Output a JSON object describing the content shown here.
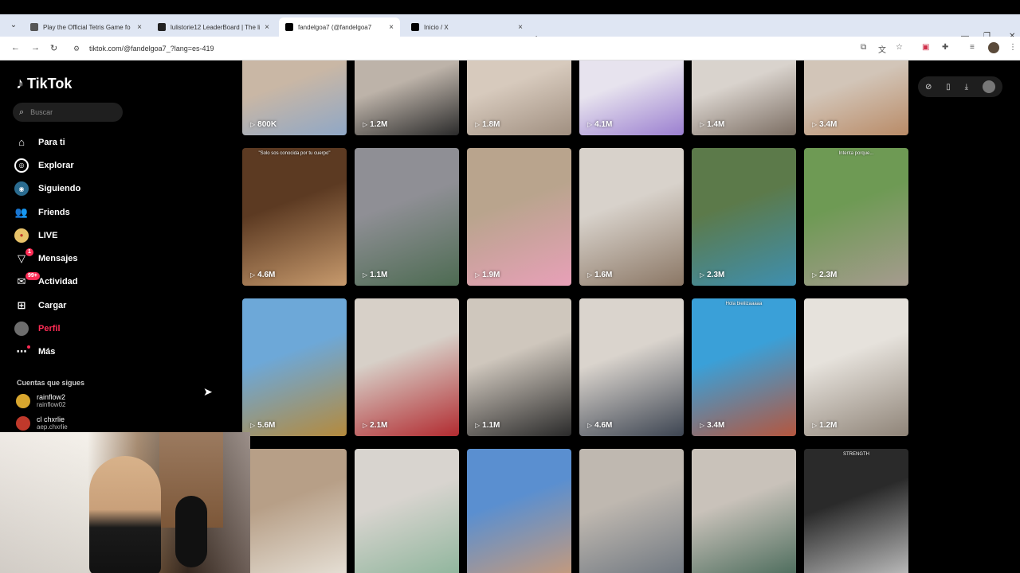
{
  "browser": {
    "tabs": [
      {
        "label": "Play the Official Tetris Game fo",
        "favicon_color": "#555555",
        "close": "×"
      },
      {
        "label": "lulistorie12 LeaderBoard | The li",
        "favicon_color": "#222222",
        "close": "×"
      },
      {
        "label": "fandelgoa7 (@fandelgoa7",
        "favicon_color": "#000000",
        "close": "×",
        "active": true
      },
      {
        "label": "Inicio / X",
        "favicon_color": "#000000",
        "close": "×"
      }
    ],
    "new_tab": "+",
    "url": "tiktok.com/@fandelgoa7_?lang=es-419"
  },
  "tiktok": {
    "logo": "TikTok",
    "search_placeholder": "Buscar",
    "nav": [
      {
        "label": "Para ti",
        "icon": "home-icon"
      },
      {
        "label": "Explorar",
        "icon": "compass-icon"
      },
      {
        "label": "Siguiendo",
        "icon": "following-icon"
      },
      {
        "label": "Friends",
        "icon": "friends-icon"
      },
      {
        "label": "LIVE",
        "icon": "live-icon"
      },
      {
        "label": "Mensajes",
        "icon": "inbox-icon",
        "badge": "1"
      },
      {
        "label": "Actividad",
        "icon": "activity-icon",
        "badge": "99+"
      },
      {
        "label": "Cargar",
        "icon": "upload-icon"
      },
      {
        "label": "Perfil",
        "icon": "profile-icon"
      },
      {
        "label": "Más",
        "icon": "more-icon"
      }
    ],
    "following_title": "Cuentas que sigues",
    "following": [
      {
        "name": "rainflow2",
        "handle": "rainflow02"
      },
      {
        "name": "cl chxrlie",
        "handle": "aep.chxrlie"
      }
    ],
    "videos": [
      {
        "views": "800K",
        "colors": [
          "#c9b7a5",
          "#8fa7c6"
        ]
      },
      {
        "views": "1.2M",
        "colors": [
          "#bdb3a9",
          "#2b2b2b"
        ]
      },
      {
        "views": "1.8M",
        "colors": [
          "#d7cabd",
          "#a08f80"
        ]
      },
      {
        "views": "4.1M",
        "colors": [
          "#e7e3ee",
          "#9b7fd0"
        ]
      },
      {
        "views": "1.4M",
        "colors": [
          "#d9d3cd",
          "#7b6d62"
        ]
      },
      {
        "views": "3.4M",
        "colors": [
          "#d2c5b8",
          "#b98b67"
        ]
      },
      {
        "views": "4.6M",
        "colors": [
          "#5c3a22",
          "#c79a6d"
        ],
        "caption": "\"Solo sos conocida por tu cuerpo\""
      },
      {
        "views": "1.1M",
        "colors": [
          "#8f8f95",
          "#4d6b52"
        ]
      },
      {
        "views": "1.9M",
        "colors": [
          "#b9a48d",
          "#e8a0b8"
        ]
      },
      {
        "views": "1.6M",
        "colors": [
          "#d8d2cb",
          "#8b7765"
        ]
      },
      {
        "views": "2.3M",
        "colors": [
          "#5c7a4a",
          "#3e8fb0"
        ]
      },
      {
        "views": "2.3M",
        "colors": [
          "#6e9a54",
          "#a69b8f"
        ],
        "caption": "Intenta porque..."
      },
      {
        "views": "5.6M",
        "colors": [
          "#6da8d8",
          "#b58a3c"
        ]
      },
      {
        "views": "2.1M",
        "colors": [
          "#d7d0c8",
          "#b22b30"
        ]
      },
      {
        "views": "1.1M",
        "colors": [
          "#cfc7bd",
          "#2a2a2a"
        ]
      },
      {
        "views": "4.6M",
        "colors": [
          "#dad4cd",
          "#3d4552"
        ]
      },
      {
        "views": "3.4M",
        "colors": [
          "#3aa0d8",
          "#b5563e"
        ],
        "caption": "Hola bieiiizaaaaa"
      },
      {
        "views": "1.2M",
        "colors": [
          "#e6e2dc",
          "#8f8478"
        ]
      },
      {
        "views": "",
        "colors": [
          "#b79f87",
          "#e6e0d6"
        ]
      },
      {
        "views": "",
        "colors": [
          "#d8d4cf",
          "#8fb59c"
        ]
      },
      {
        "views": "",
        "colors": [
          "#5a8fd0",
          "#c59a7c"
        ]
      },
      {
        "views": "",
        "colors": [
          "#bfb8b0",
          "#6f7780"
        ]
      },
      {
        "views": "",
        "colors": [
          "#c9c2ba",
          "#4c6c5c"
        ]
      },
      {
        "views": "",
        "colors": [
          "#2a2a2a",
          "#bcbcbc"
        ],
        "caption": "STRENGTH"
      }
    ]
  },
  "overlay": {
    "cursor": "➤"
  }
}
